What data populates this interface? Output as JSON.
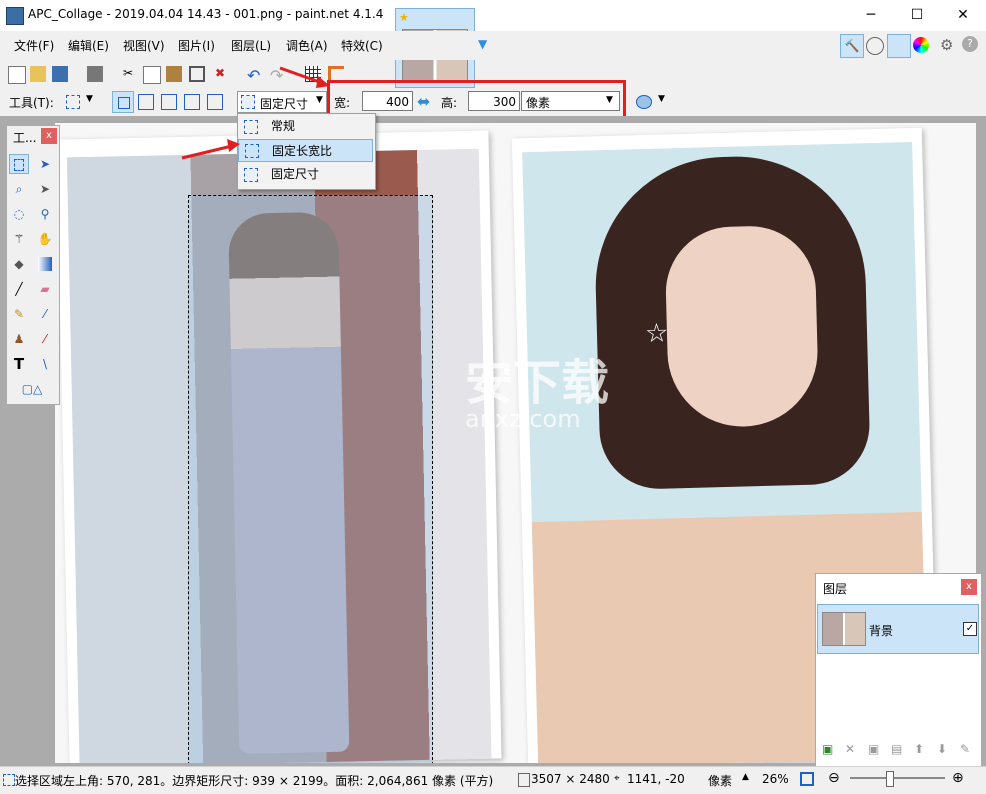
{
  "window": {
    "title": "APC_Collage - 2019.04.04 14.43 - 001.png - paint.net 4.1.4",
    "minimize": "─",
    "maximize": "☐",
    "close": "✕"
  },
  "menu": [
    "文件(F)",
    "编辑(E)",
    "视图(V)",
    "图片(I)",
    "图层(L)",
    "调色(A)",
    "特效(C)"
  ],
  "optbar": {
    "tool_label": "工具(T):",
    "selection_mode": "固定尺寸",
    "width_label": "宽:",
    "width_value": "400",
    "height_label": "高:",
    "height_value": "300",
    "unit": "像素"
  },
  "dropdown": {
    "items": [
      "常规",
      "固定长宽比",
      "固定尺寸"
    ]
  },
  "tools_panel": {
    "title": "工..."
  },
  "layers_panel": {
    "title": "图层",
    "layer_name": "背景"
  },
  "watermark": {
    "cn": "安下载",
    "en": "anxz.com"
  },
  "status": {
    "selection_info": "选择区域左上角: 570, 281。边界矩形尺寸: 939 × 2199。面积: 2,064,861 像素 (平方)",
    "image_size": "3507 × 2480",
    "cursor_pos": "1141, -20",
    "unit": "像素",
    "zoom": "26%"
  },
  "colors": {
    "accent": "#cce4f7",
    "red_highlight": "#e02020",
    "selection_blue": "#9cc3e5"
  }
}
